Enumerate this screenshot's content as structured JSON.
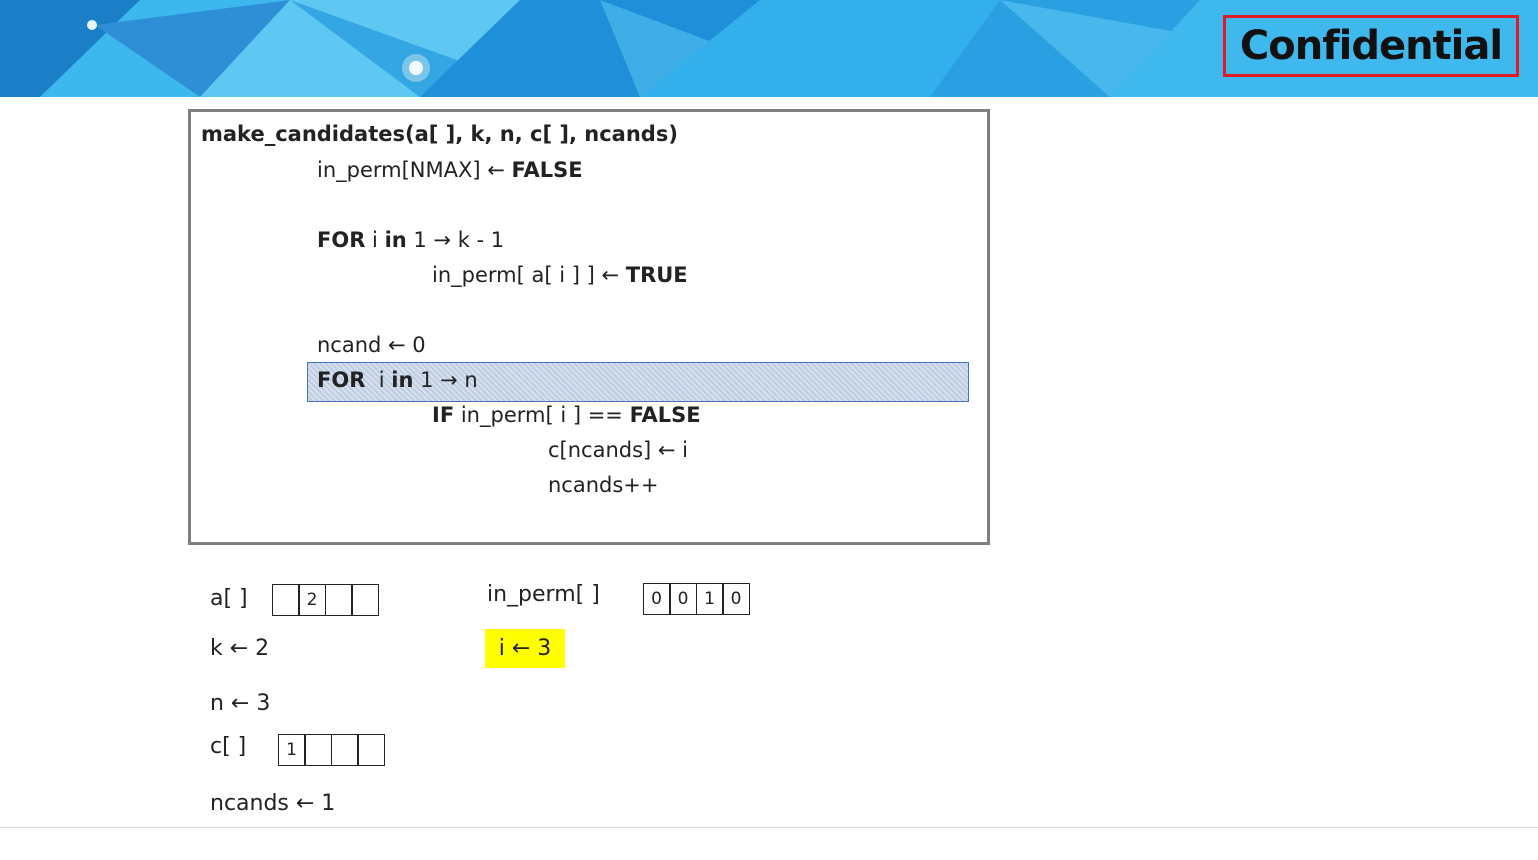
{
  "banner": {
    "badge_text": "Confidential",
    "colors": {
      "base": "#2aa8e6",
      "dark": "#1b7fc8",
      "light": "#5fc8f2",
      "badge_border": "#e01b24"
    }
  },
  "code": {
    "signature": "make_candidates(a[ ], k, n, c[ ], ncands)",
    "lines": [
      {
        "kw1": "",
        "text1": "in_perm[NMAX] ← ",
        "kw2": "FALSE",
        "text2": ""
      },
      {
        "kw1": "FOR",
        "text1": " i ",
        "kw2": "in",
        "text2": " 1 → k - 1"
      },
      {
        "kw1": "",
        "text1": "in_perm[ a[ i ] ] ← ",
        "kw2": "TRUE",
        "text2": ""
      },
      {
        "kw1": "",
        "text1": "ncand ← 0",
        "kw2": "",
        "text2": ""
      },
      {
        "kw1": "FOR",
        "text1": "  i ",
        "kw2": "in",
        "text2": " 1 → n"
      },
      {
        "kw1": "IF",
        "text1": " in_perm[ i ] == ",
        "kw2": "FALSE",
        "text2": ""
      },
      {
        "kw1": "",
        "text1": "c[ncands] ← i",
        "kw2": "",
        "text2": ""
      },
      {
        "kw1": "",
        "text1": "ncands++",
        "kw2": "",
        "text2": ""
      }
    ],
    "highlighted_line": 4
  },
  "state": {
    "a_label": "a[ ]",
    "a_cells": [
      "",
      "2",
      "",
      ""
    ],
    "k_text": "k ← 2",
    "n_text": "n ← 3",
    "c_label": "c[ ]",
    "c_cells": [
      "1",
      "",
      "",
      ""
    ],
    "ncands_text": "ncands ← 1",
    "in_perm_label": "in_perm[ ]",
    "in_perm_cells": [
      "0",
      "0",
      "1",
      "0"
    ],
    "i_text": "i ← 3",
    "i_highlight_color": "#ffff00"
  }
}
